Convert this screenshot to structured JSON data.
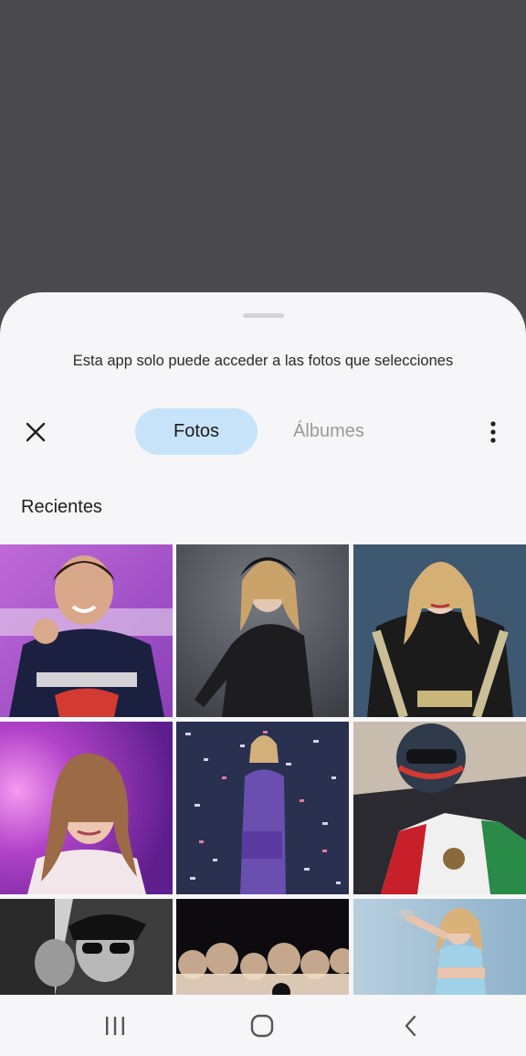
{
  "sheet": {
    "notice": "Esta app solo puede acceder a las fotos que selecciones",
    "tabs": [
      {
        "label": "Fotos",
        "selected": true
      },
      {
        "label": "Álbumes",
        "selected": false
      }
    ],
    "section_title": "Recientes"
  },
  "photos": [
    {
      "subject": "racing driver in red team suit with fist raised",
      "palette": [
        "#b25ad0",
        "#1a1f3a"
      ]
    },
    {
      "subject": "singer in black sequined hooded outfit",
      "palette": [
        "#5b5e66",
        "#1a1a1c"
      ]
    },
    {
      "subject": "singer in black and gold beaded outfit",
      "palette": [
        "#30475e",
        "#b9b190"
      ]
    },
    {
      "subject": "singer under purple and pink stage lights",
      "palette": [
        "#7a2aa8",
        "#e070e0"
      ]
    },
    {
      "subject": "singer on stage with confetti",
      "palette": [
        "#2c3450",
        "#7a56b8"
      ]
    },
    {
      "subject": "racing driver in helmet with Mexican flag",
      "palette": [
        "#c9c0b0",
        "#1e1e24"
      ]
    },
    {
      "subject": "black and white photo of driver in cap and sunglasses",
      "palette": [
        "#d8d8d8",
        "#151515"
      ]
    },
    {
      "subject": "dark stage with blurred lights",
      "palette": [
        "#0e0c10",
        "#d9b89c"
      ]
    },
    {
      "subject": "singer with microphone in light blue outfit",
      "palette": [
        "#a9c4d8",
        "#e8c8a0"
      ]
    }
  ],
  "nav": {
    "recents_icon": "recents-icon",
    "home_icon": "home-icon",
    "back_icon": "back-icon"
  }
}
